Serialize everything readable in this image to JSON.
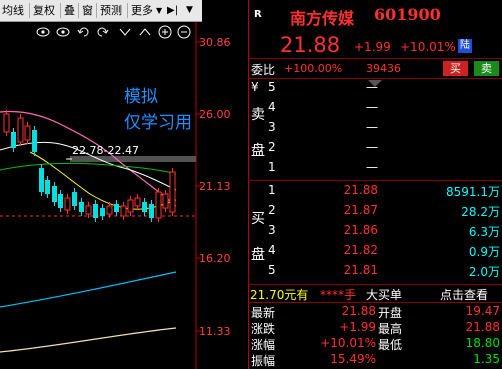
{
  "toolbar": {
    "items": [
      "均线",
      "复权",
      "叠",
      "窗",
      "预测",
      "更多"
    ],
    "more_arrow": "▼",
    "nav_icon": "▶|",
    "arrow_down": "▼"
  },
  "icons": [
    "eye-icon",
    "eye-icon",
    "undo-icon",
    "redo-icon",
    "chevron-down-icon",
    "up-icon",
    "plus-icon",
    "minus-icon"
  ],
  "chart": {
    "price_levels": [
      "30.86",
      "26.00",
      "21.13",
      "16.20",
      "11.33"
    ],
    "range_label": "22.78-22.47"
  },
  "watermark": {
    "line1": "模拟",
    "line2": "仅学习用"
  },
  "stock": {
    "badge": "R",
    "name": "南方传媒",
    "code": "601900",
    "price": "21.88",
    "change": "+1.99",
    "change_pct": "+10.01%",
    "market_tag": "陆"
  },
  "order_ratio": {
    "label": "委比",
    "pct": "+100.00%",
    "diff": "39436",
    "buy_btn": "买",
    "sell_btn": "卖"
  },
  "sell_side": {
    "label_chars": [
      "卖",
      "盘"
    ],
    "levels": [
      {
        "n": "5",
        "price": "—",
        "vol": ""
      },
      {
        "n": "4",
        "price": "—",
        "vol": ""
      },
      {
        "n": "3",
        "price": "—",
        "vol": ""
      },
      {
        "n": "2",
        "price": "—",
        "vol": ""
      },
      {
        "n": "1",
        "price": "—",
        "vol": ""
      }
    ],
    "yen": "¥"
  },
  "buy_side": {
    "label_chars": [
      "买",
      "盘"
    ],
    "levels": [
      {
        "n": "1",
        "price": "21.88",
        "vol": "8591.1万"
      },
      {
        "n": "2",
        "price": "21.87",
        "vol": "28.2万"
      },
      {
        "n": "3",
        "price": "21.86",
        "vol": "6.3万"
      },
      {
        "n": "4",
        "price": "21.82",
        "vol": "0.9万"
      },
      {
        "n": "5",
        "price": "21.81",
        "vol": "2.0万"
      }
    ]
  },
  "trade_line": {
    "price": "21.70元有",
    "who": "****手",
    "action": "大买单",
    "link": "点击查看"
  },
  "stats": [
    {
      "l1": "最新",
      "v1": "21.88",
      "l2": "开盘",
      "v2": "19.47"
    },
    {
      "l1": "涨跌",
      "v1": "+1.99",
      "l2": "最高",
      "v2": "21.88"
    },
    {
      "l1": "涨幅",
      "v1": "+10.01%",
      "l2": "最低",
      "v2": "18.80"
    },
    {
      "l1": "振幅",
      "v1": "15.49%",
      "l2": "",
      "v2": "1.35"
    }
  ],
  "colors": {
    "up": "#ff3030",
    "down": "#00e000",
    "accent": "#1e90ff"
  }
}
